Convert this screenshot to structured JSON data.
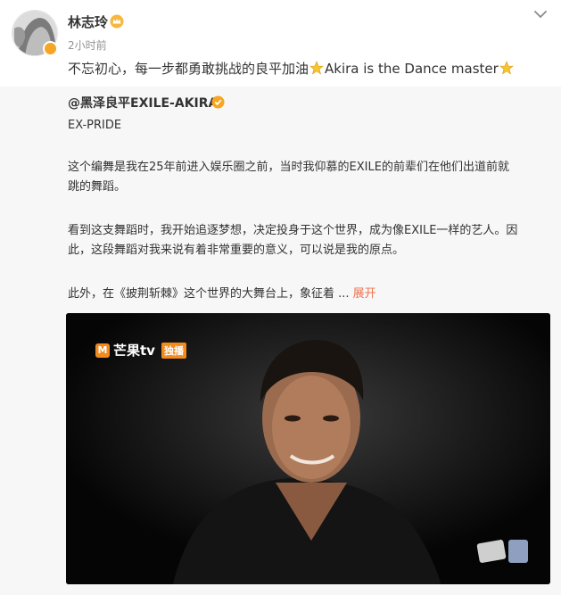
{
  "post": {
    "username": "林志玲",
    "timestamp": "2小时前",
    "text_before_star": "不忘初心，每一步都勇敢挑战的良平加油",
    "text_after_star": "Akira is the Dance master",
    "icons": {
      "vip": "gold-crown-icon",
      "more": "chevron-down-icon",
      "emoji": "star-icon"
    }
  },
  "repost": {
    "author": "@黑泽良平EXILE-AKIRA",
    "line1": "EX-PRIDE",
    "para1_line1": "这个编舞是我在25年前进入娱乐圈之前，当时我仰慕的EXILE的前辈们在他们出道前就",
    "para1_line2": "跳的舞蹈。",
    "para2_line1": "看到这支舞蹈时，我开始追逐梦想，决定投身于这个世界，成为像EXILE一样的艺人。因",
    "para2_line2": "此，这段舞蹈对我来说有着非常重要的意义，可以说是我的原点。",
    "para3": "此外，在《披荆斩棘》这个世界的大舞台上，象征着 ...",
    "expand_label": "展开"
  },
  "video": {
    "watermark_logo": "M",
    "watermark_text": "芒果tv",
    "watermark_tag": "独播"
  },
  "colors": {
    "link": "#eb7350",
    "background": "#ffffff",
    "repost_bg": "#f7f7f7",
    "accent": "#f28a1e"
  }
}
